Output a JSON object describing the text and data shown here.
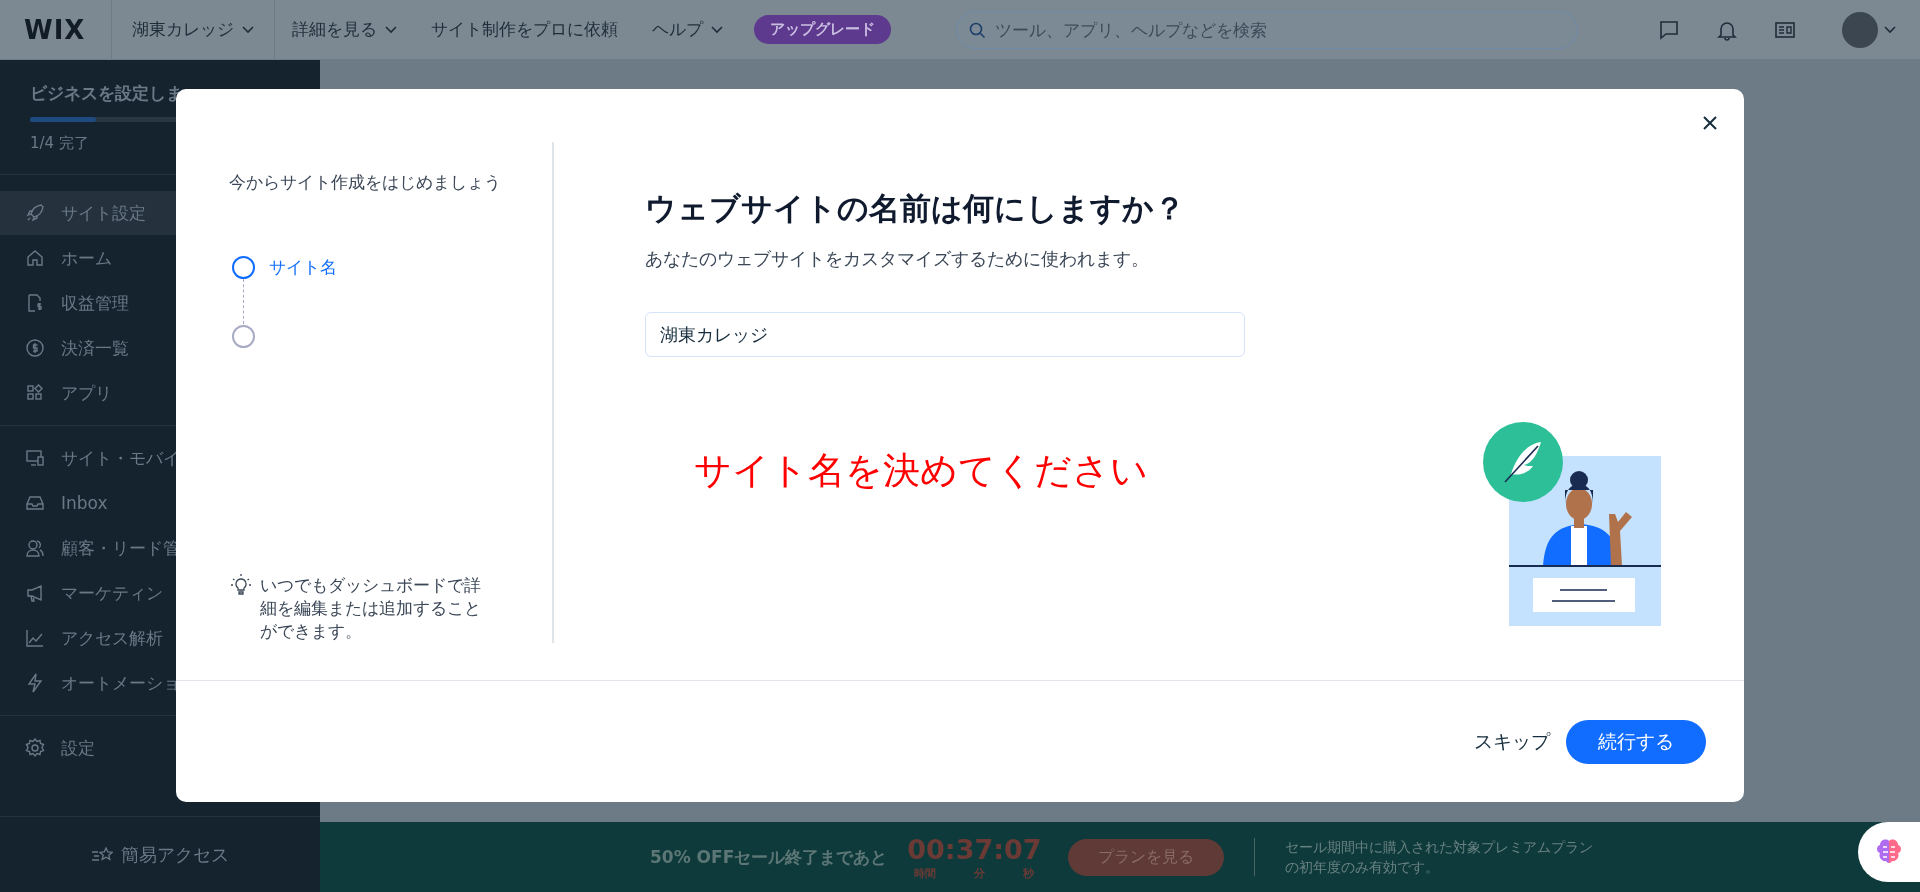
{
  "top_bar": {
    "logo": "WIX",
    "nav": [
      {
        "label": "湖東カレッジ",
        "dropdown": true
      },
      {
        "label": "詳細を見る",
        "dropdown": true
      },
      {
        "label": "サイト制作をプロに依頼",
        "dropdown": false
      },
      {
        "label": "ヘルプ",
        "dropdown": true
      }
    ],
    "upgrade_badge": "アップグレード",
    "search": {
      "placeholder": "ツール、アプリ、ヘルプなどを検索"
    }
  },
  "sidebar": {
    "setup_title": "ビジネスを設定しま",
    "setup_progress": {
      "level": 0.25,
      "reading": "1/4 完了"
    },
    "groups": [
      [
        {
          "label": "サイト設定",
          "selected": true
        },
        {
          "label": "ホーム",
          "selected": false
        },
        {
          "label": "収益管理",
          "selected": false
        },
        {
          "label": "決済一覧",
          "selected": false
        },
        {
          "label": "アプリ",
          "selected": false
        }
      ],
      [
        {
          "label": "サイト・モバイ",
          "selected": false
        },
        {
          "label": "Inbox",
          "selected": false
        },
        {
          "label": "顧客・リード管",
          "selected": false
        },
        {
          "label": "マーケティン",
          "selected": false
        },
        {
          "label": "アクセス解析",
          "selected": false
        },
        {
          "label": "オートメーショ",
          "selected": false
        }
      ],
      [
        {
          "label": "設定",
          "selected": false
        }
      ]
    ],
    "quick_access": "簡易アクセス"
  },
  "modal": {
    "intro": "今からサイト作成をはじめましょう",
    "steps": [
      {
        "label": "サイト名",
        "selected": true
      },
      {
        "selected": false
      }
    ],
    "tip": "いつでもダッシュボードで詳細を編集または追加することができます。",
    "title": "ウェブサイトの名前は何にしますか？",
    "subtitle": "あなたのウェブサイトをカスタマイズするために使われます。",
    "site_name_field": {
      "value": "湖東カレッジ"
    },
    "annotation": "サイト名を決めてください",
    "skip": "スキップ",
    "continue": "続行する"
  },
  "promo_bar": {
    "headline": "50% OFFセール終了まであと",
    "timer": "00:37:07",
    "timer_units": [
      "時間",
      "分",
      "秒"
    ],
    "plan_button": "プランを見る",
    "note": "セール期間中に購入された対象プレミアムプランの初年度のみ有効です。"
  }
}
